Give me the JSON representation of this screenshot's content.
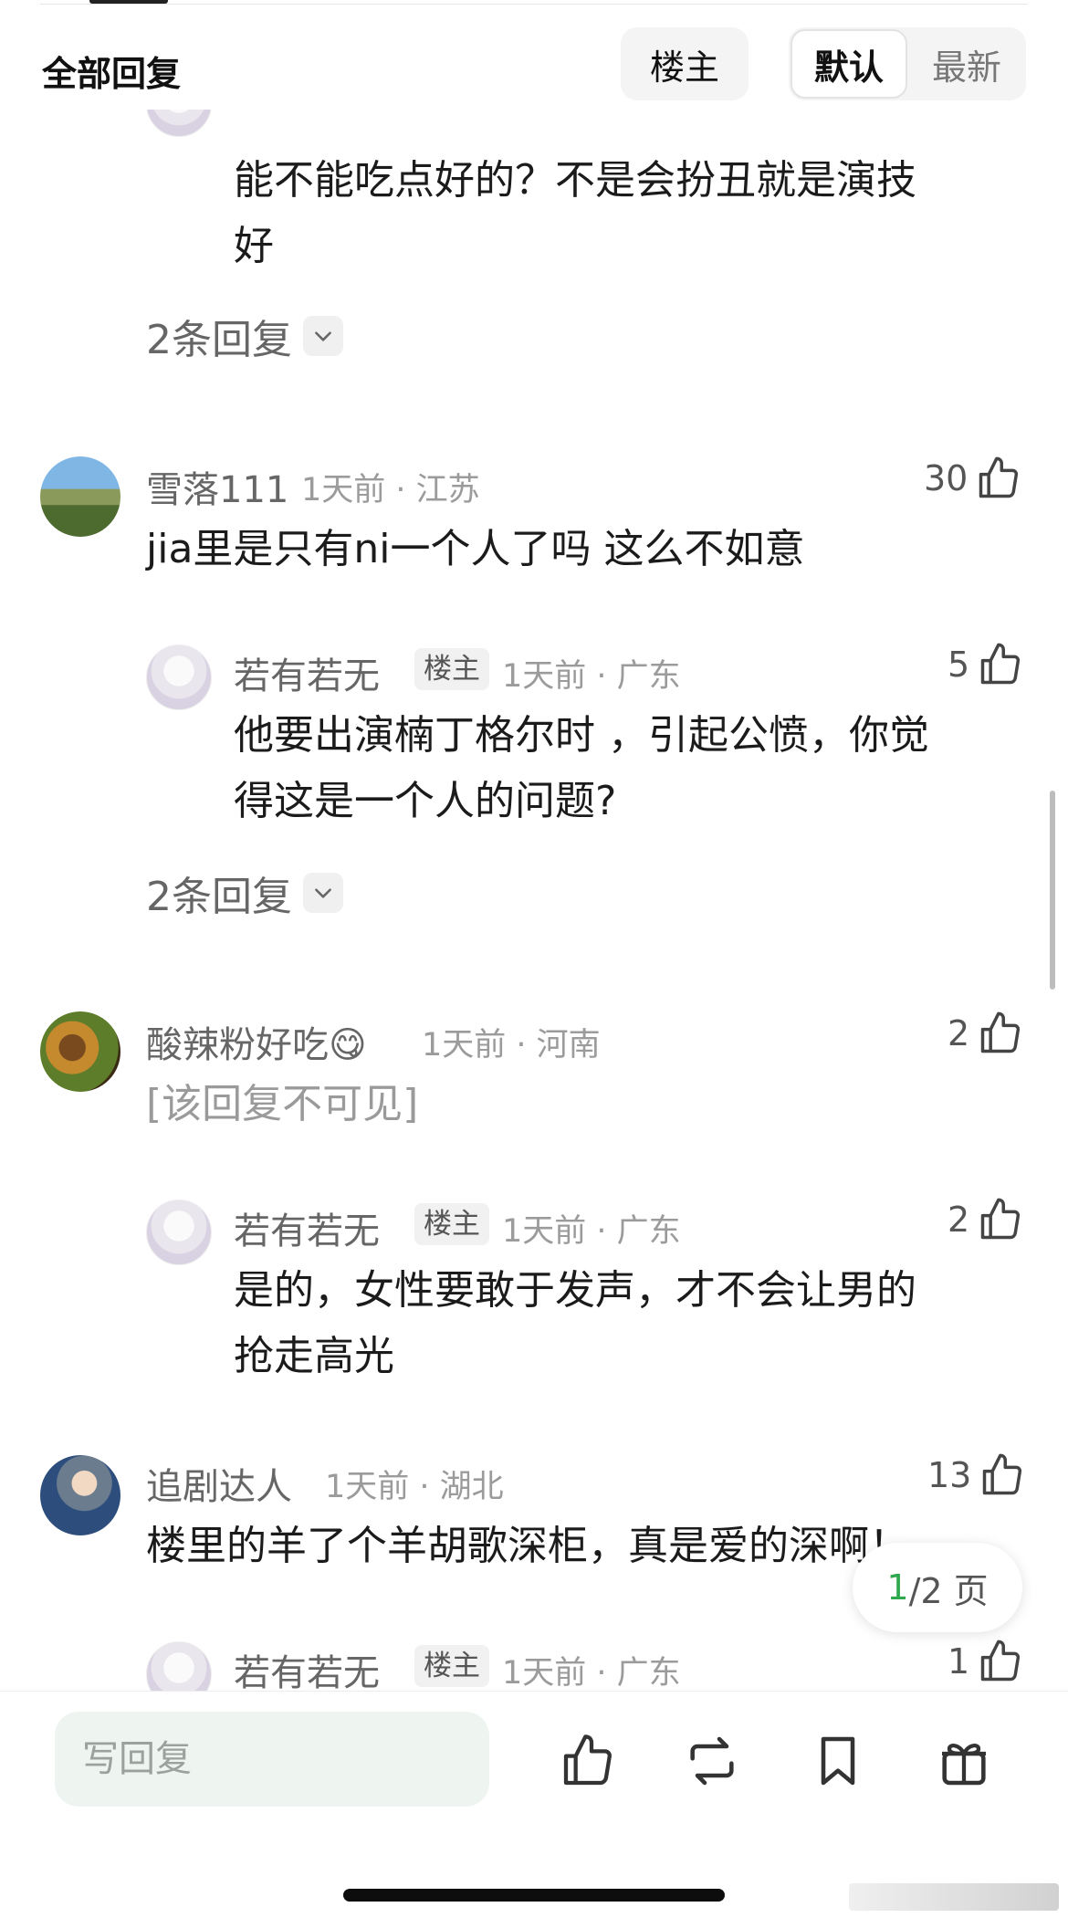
{
  "header": {
    "title": "全部回复",
    "louzhu_button": "楼主",
    "sort_default": "默认",
    "sort_latest": "最新"
  },
  "partial_top": {
    "text_line1": "能不能吃点好的？不是会扮丑就是演技",
    "text_line2": "好",
    "replies": "2条回复"
  },
  "comments": [
    {
      "user": "雪落111",
      "time_loc": "1天前 · 江苏",
      "likes": "30",
      "text": "jia里是只有ni一个人了吗  这么不如意",
      "reply": {
        "user": "若有若无",
        "badge": "楼主",
        "time_loc": "1天前 · 广东",
        "likes": "5",
        "text_line1": "他要出演楠丁格尔时 ，引起公愤，你觉",
        "text_line2": "得这是一个人的问题?"
      },
      "replies": "2条回复"
    },
    {
      "user": "酸辣粉好吃😋",
      "time_loc": "1天前 · 河南",
      "likes": "2",
      "text": "[该回复不可见]",
      "reply": {
        "user": "若有若无",
        "badge": "楼主",
        "time_loc": "1天前 · 广东",
        "likes": "2",
        "text_line1": "是的，女性要敢于发声，才不会让男的",
        "text_line2": "抢走高光"
      }
    },
    {
      "user": "追剧达人",
      "time_loc": "1天前 · 湖北",
      "likes": "13",
      "text": "楼里的羊了个羊胡歌深柜，真是爱的深啊！",
      "reply": {
        "user": "若有若无",
        "badge": "楼主",
        "time_loc": "1天前 · 广东",
        "likes": "1"
      }
    }
  ],
  "pager": {
    "current": "1",
    "rest": "/2 页"
  },
  "bottom": {
    "reply_placeholder": "写回复",
    "icons": [
      "like-icon",
      "repost-icon",
      "bookmark-icon",
      "gift-icon"
    ]
  }
}
